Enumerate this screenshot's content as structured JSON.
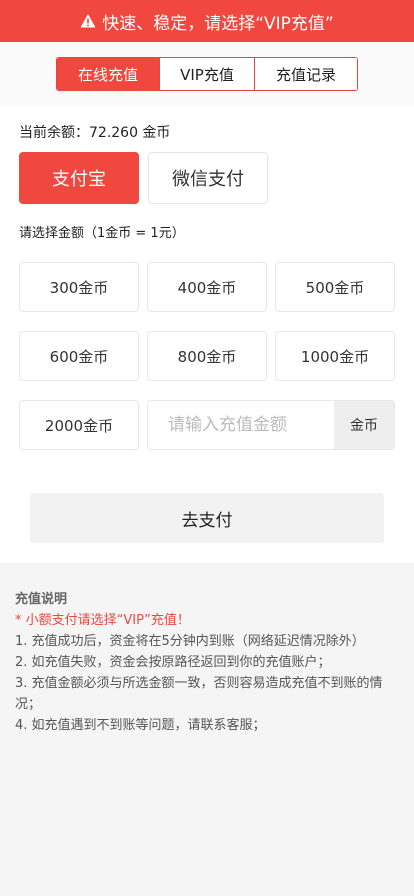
{
  "banner": {
    "text": "快速、稳定，请选择“VIP充值”"
  },
  "tabs": [
    {
      "label": "在线充值",
      "active": true
    },
    {
      "label": "VIP充值",
      "active": false
    },
    {
      "label": "充值记录",
      "active": false
    }
  ],
  "balance": {
    "text": "当前余额：72.260 金币"
  },
  "pay_methods": [
    {
      "label": "支付宝",
      "active": true
    },
    {
      "label": "微信支付",
      "active": false
    }
  ],
  "amount_hint": "请选择金额（1金币 = 1元）",
  "amounts": [
    "300金币",
    "400金币",
    "500金币",
    "600金币",
    "800金币",
    "1000金币",
    "2000金币"
  ],
  "custom": {
    "placeholder": "请输入充值金额",
    "unit": "金币"
  },
  "submit_label": "去支付",
  "notes": {
    "title": "充值说明",
    "highlight": "* 小额支付请选择“VIP”充值！",
    "items": [
      "1. 充值成功后，资金将在5分钟内到账（网络延迟情况除外）",
      "2. 如充值失败，资金会按原路径返回到你的充值账户；",
      "3. 充值金额必须与所选金额一致，否则容易造成充值不到账的情况；",
      "4. 如充值遇到不到账等问题，请联系客服；"
    ]
  },
  "colors": {
    "accent": "#f0483e"
  },
  "icons": {
    "banner": "warning-icon"
  }
}
